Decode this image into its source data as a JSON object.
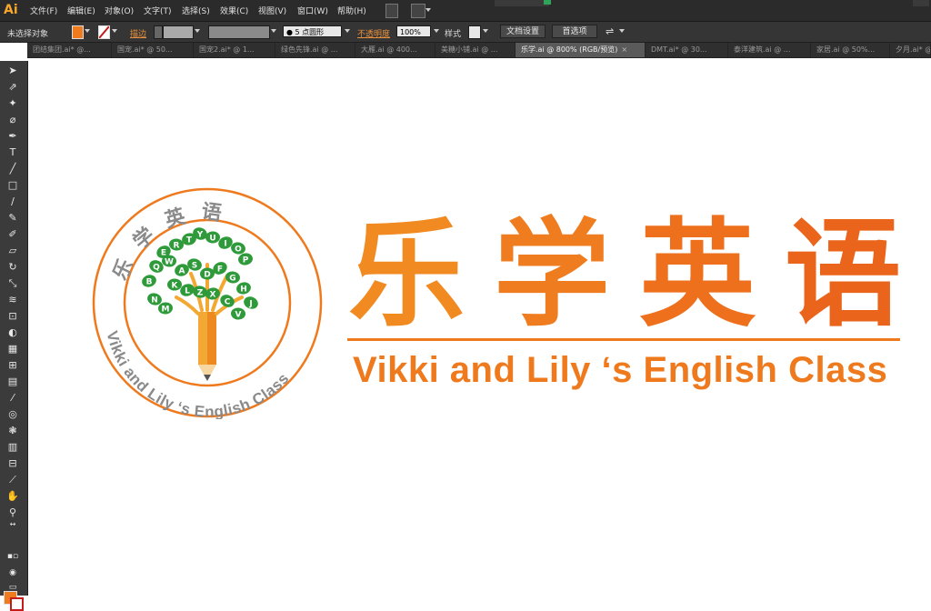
{
  "app": {
    "logo": "Ai"
  },
  "menubar": {
    "items": [
      "文件(F)",
      "编辑(E)",
      "对象(O)",
      "文字(T)",
      "选择(S)",
      "效果(C)",
      "视图(V)",
      "窗口(W)",
      "帮助(H)"
    ]
  },
  "control": {
    "selection_label": "未选择对象",
    "stroke_label": "描边",
    "brush_value": "5 点圆形",
    "opacity_label": "不透明度",
    "opacity_value": "100%",
    "style_label": "样式",
    "doc_setup_label": "文档设置",
    "prefs_label": "首选项",
    "fill_color": "#ef7b1f"
  },
  "tabs": [
    {
      "label": "团结集团.ai* @...",
      "active": false
    },
    {
      "label": "国宠.ai* @ 50...",
      "active": false
    },
    {
      "label": "国宠2.ai* @ 1...",
      "active": false
    },
    {
      "label": "绿色先锋.ai @ ...",
      "active": false
    },
    {
      "label": "大雁.ai @ 400...",
      "active": false
    },
    {
      "label": "美糖小铺.ai @ ...",
      "active": false
    },
    {
      "label": "乐学.ai @ 800% (RGB/预览)",
      "active": true
    },
    {
      "label": "DMT.ai* @ 30...",
      "active": false
    },
    {
      "label": "泰洋建筑.ai @ ...",
      "active": false
    },
    {
      "label": "家居.ai @ 50%...",
      "active": false
    },
    {
      "label": "夕月.ai* @ ...",
      "active": false
    }
  ],
  "tools": [
    "selection-tool",
    "direct-selection-tool",
    "magic-wand-tool",
    "lasso-tool",
    "pen-tool",
    "type-tool",
    "line-tool",
    "rectangle-tool",
    "paintbrush-tool",
    "pencil-tool",
    "blob-brush-tool",
    "eraser-tool",
    "rotate-tool",
    "scale-tool",
    "warp-tool",
    "free-transform-tool",
    "shape-builder-tool",
    "perspective-tool",
    "mesh-tool",
    "gradient-tool",
    "eyedropper-tool",
    "blend-tool",
    "symbol-sprayer-tool",
    "column-graph-tool",
    "artboard-tool",
    "slice-tool",
    "hand-tool",
    "zoom-tool"
  ],
  "artwork": {
    "circle_text_top": "乐学英语",
    "circle_text_bottom": "Vikki and Lily  ‘s English Class",
    "tree_letters": [
      "E",
      "R",
      "T",
      "Y",
      "U",
      "I",
      "O",
      "P",
      "Q",
      "W",
      "A",
      "S",
      "D",
      "F",
      "G",
      "H",
      "J",
      "K",
      "L",
      "Z",
      "X",
      "C",
      "V",
      "B",
      "N",
      "M"
    ],
    "wordmark": [
      "乐",
      "学",
      "英",
      "语"
    ],
    "subtitle": "Vikki and Lily  ‘s English Class",
    "colors": {
      "orange": "#ef7a1e",
      "green": "#2e9a3a",
      "gray": "#8a8a8a"
    }
  }
}
